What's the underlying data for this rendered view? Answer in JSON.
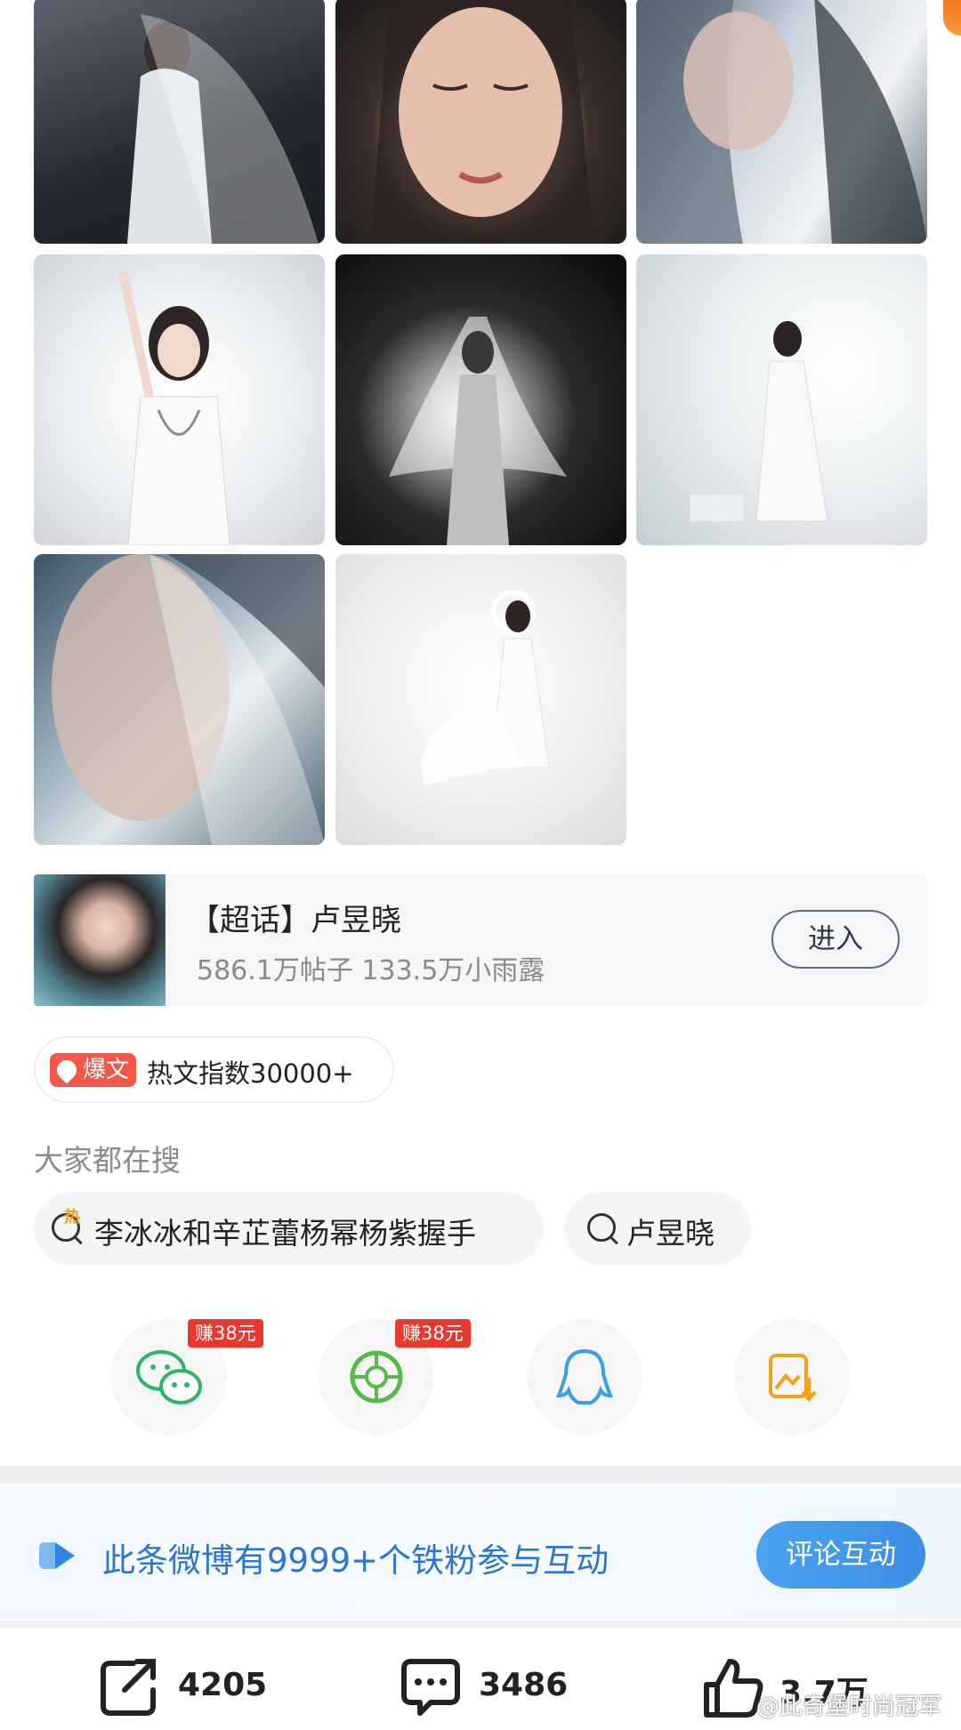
{
  "photos": [
    {
      "name": "photo-1",
      "subject": "woman in white gown with veil, dark background"
    },
    {
      "name": "photo-2",
      "subject": "close-up portrait, eyes closed"
    },
    {
      "name": "photo-3",
      "subject": "profile under sheer veil"
    },
    {
      "name": "photo-4",
      "subject": "woman in white corset gown raising arm"
    },
    {
      "name": "photo-5",
      "subject": "black and white silhouette with glowing veil"
    },
    {
      "name": "photo-6",
      "subject": "woman in white dress on bright set"
    },
    {
      "name": "photo-7",
      "subject": "close-up through translucent veil"
    },
    {
      "name": "photo-8",
      "subject": "full-length white gown with halo"
    }
  ],
  "topic": {
    "title": "【超话】卢昱晓",
    "stats": "586.1万帖子 133.5万小雨露",
    "enter_label": "进入"
  },
  "hot": {
    "tag": "爆文",
    "text": "热文指数30000+"
  },
  "search": {
    "heading": "大家都在搜",
    "chips": [
      {
        "text": "李冰冰和辛芷蕾杨幂杨紫握手",
        "hot_mark": "热"
      },
      {
        "text": "卢昱晓"
      }
    ]
  },
  "share": {
    "earn_label_1": "赚38元",
    "earn_label_2": "赚38元",
    "icons": [
      "wechat-icon",
      "moments-icon",
      "qq-icon",
      "save-image-icon"
    ],
    "colors": {
      "wechat": "#2fb36b",
      "moments": "#58b84a",
      "qq": "#3a9ee8",
      "save": "#f0a21d"
    }
  },
  "fans": {
    "text": "此条微博有9999+个铁粉参与互动",
    "button": "评论互动"
  },
  "actions": {
    "repost": "4205",
    "comment": "3486",
    "like": "3.7万"
  },
  "watermark": "@此奇堡时尚冠军"
}
